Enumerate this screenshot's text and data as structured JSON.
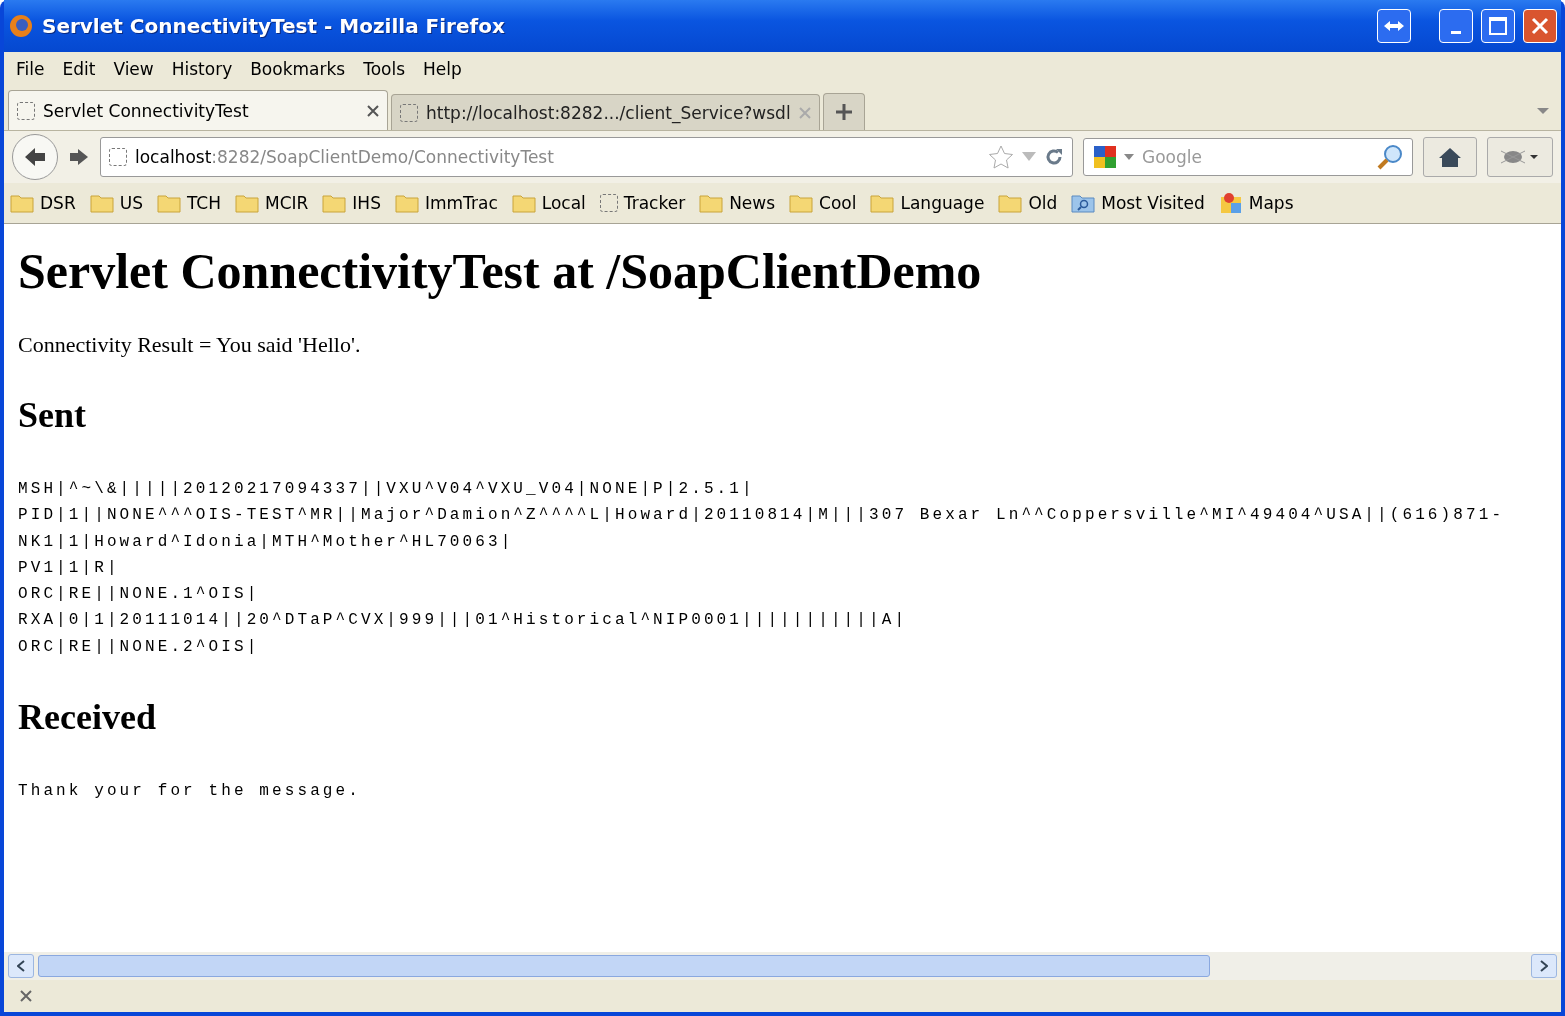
{
  "window": {
    "title": "Servlet ConnectivityTest - Mozilla Firefox"
  },
  "menu": [
    {
      "label": "File"
    },
    {
      "label": "Edit"
    },
    {
      "label": "View"
    },
    {
      "label": "History"
    },
    {
      "label": "Bookmarks"
    },
    {
      "label": "Tools"
    },
    {
      "label": "Help"
    }
  ],
  "tabs": [
    {
      "label": "Servlet ConnectivityTest",
      "selected": true
    },
    {
      "label": "http://localhost:8282.../client_Service?wsdl",
      "selected": false
    }
  ],
  "navigation": {
    "url_host": "localhost",
    "url_rest": ":8282/SoapClientDemo/ConnectivityTest",
    "search_placeholder": "Google"
  },
  "bookmarks": [
    {
      "label": "DSR",
      "kind": "folder"
    },
    {
      "label": "US",
      "kind": "folder"
    },
    {
      "label": "TCH",
      "kind": "folder"
    },
    {
      "label": "MCIR",
      "kind": "folder"
    },
    {
      "label": "IHS",
      "kind": "folder"
    },
    {
      "label": "ImmTrac",
      "kind": "folder"
    },
    {
      "label": "Local",
      "kind": "folder"
    },
    {
      "label": "Tracker",
      "kind": "page"
    },
    {
      "label": "News",
      "kind": "folder"
    },
    {
      "label": "Cool",
      "kind": "folder"
    },
    {
      "label": "Language",
      "kind": "folder"
    },
    {
      "label": "Old",
      "kind": "folder"
    },
    {
      "label": "Most Visited",
      "kind": "smart"
    },
    {
      "label": "Maps",
      "kind": "maps"
    }
  ],
  "page": {
    "heading": "Servlet ConnectivityTest at /SoapClientDemo",
    "result": "Connectivity Result = You said 'Hello'.",
    "sections": [
      {
        "heading": "Sent",
        "lines": [
          "MSH|^~\\&|||||20120217094337||VXU^V04^VXU_V04|NONE|P|2.5.1|",
          "PID|1||NONE^^^OIS-TEST^MR||Major^Damion^Z^^^^L|Howard|20110814|M|||307 Bexar Ln^^Coppersville^MI^49404^USA||(616)871-",
          "NK1|1|Howard^Idonia|MTH^Mother^HL70063|",
          "PV1|1|R|",
          "ORC|RE||NONE.1^OIS|",
          "RXA|0|1|20111014||20^DTaP^CVX|999|||01^Historical^NIP0001|||||||||||A|",
          "ORC|RE||NONE.2^OIS|"
        ]
      },
      {
        "heading": "Received",
        "lines": [
          "Thank your for the message."
        ]
      }
    ]
  }
}
